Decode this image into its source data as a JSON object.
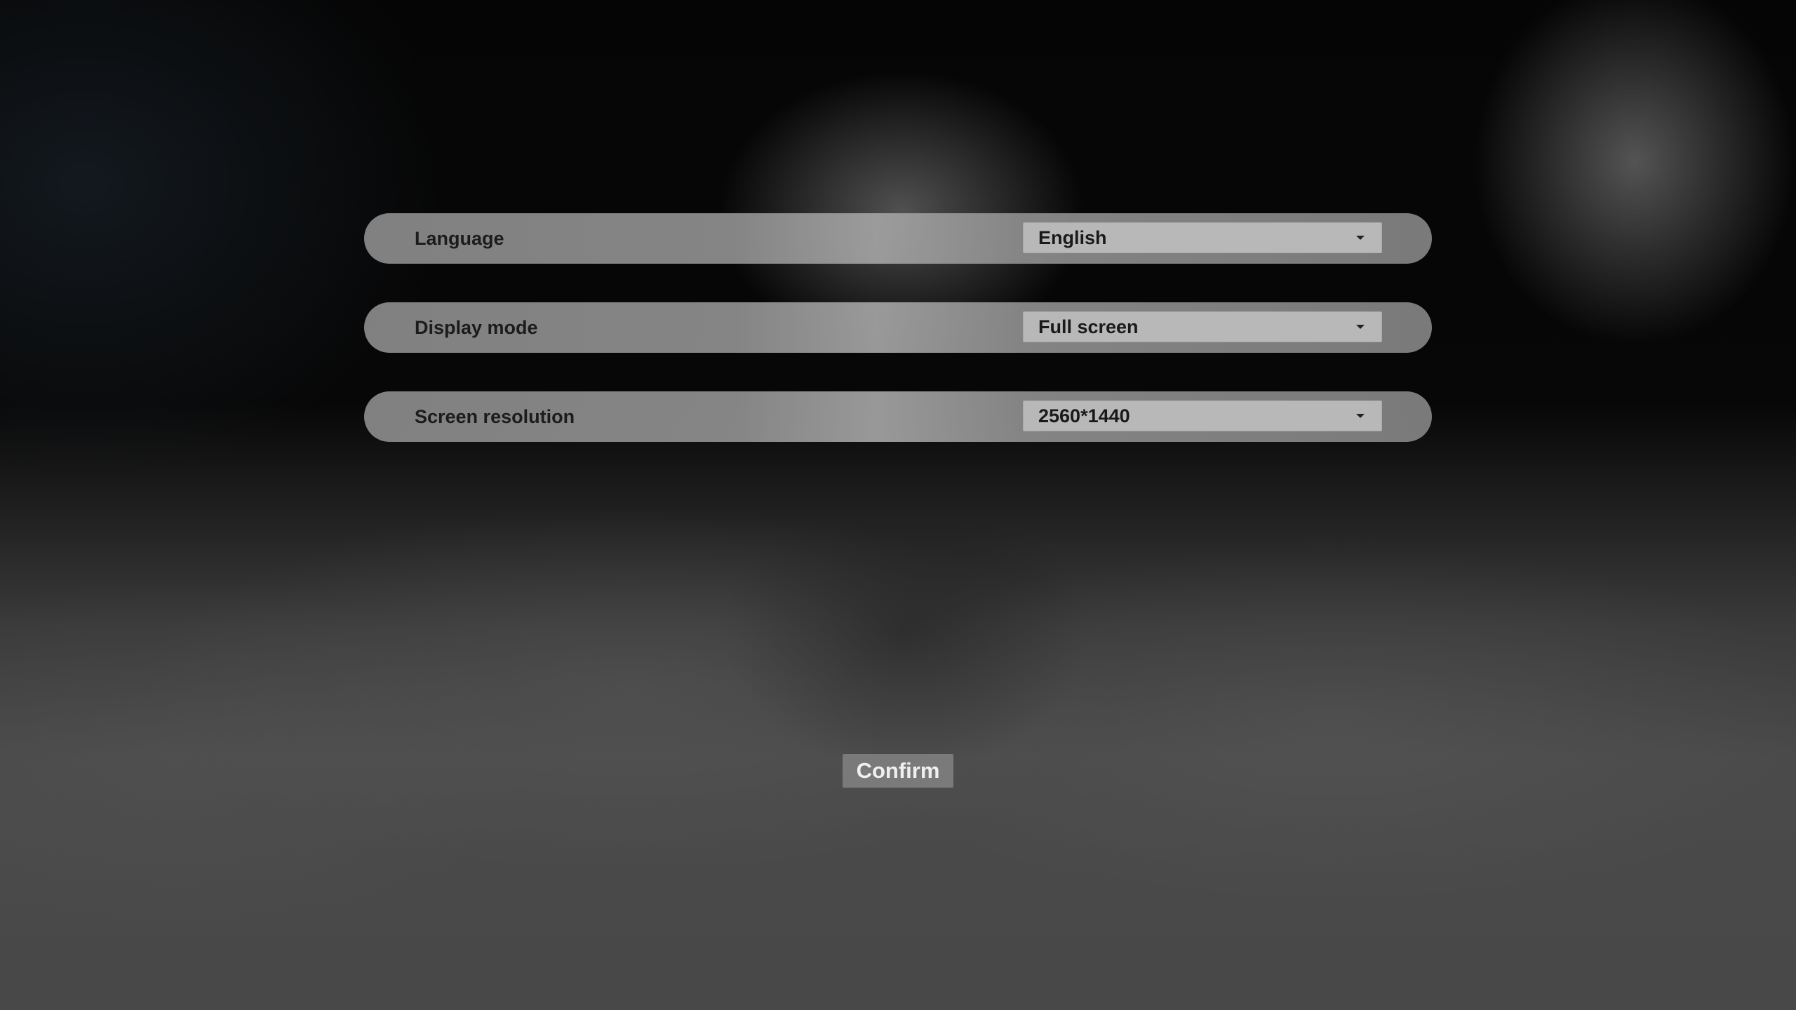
{
  "settings": {
    "items": [
      {
        "label": "Language",
        "value": "English"
      },
      {
        "label": "Display mode",
        "value": "Full screen"
      },
      {
        "label": "Screen resolution",
        "value": "2560*1440"
      }
    ]
  },
  "actions": {
    "confirm_label": "Confirm"
  },
  "icons": {
    "dropdown": "chevron-down-icon"
  },
  "colors": {
    "row_background": "#8a8a8a",
    "dropdown_background": "#b8b8b8",
    "button_background": "#7a7a7a",
    "label_text": "#1c1c1c",
    "button_text": "#f0f0f0"
  }
}
